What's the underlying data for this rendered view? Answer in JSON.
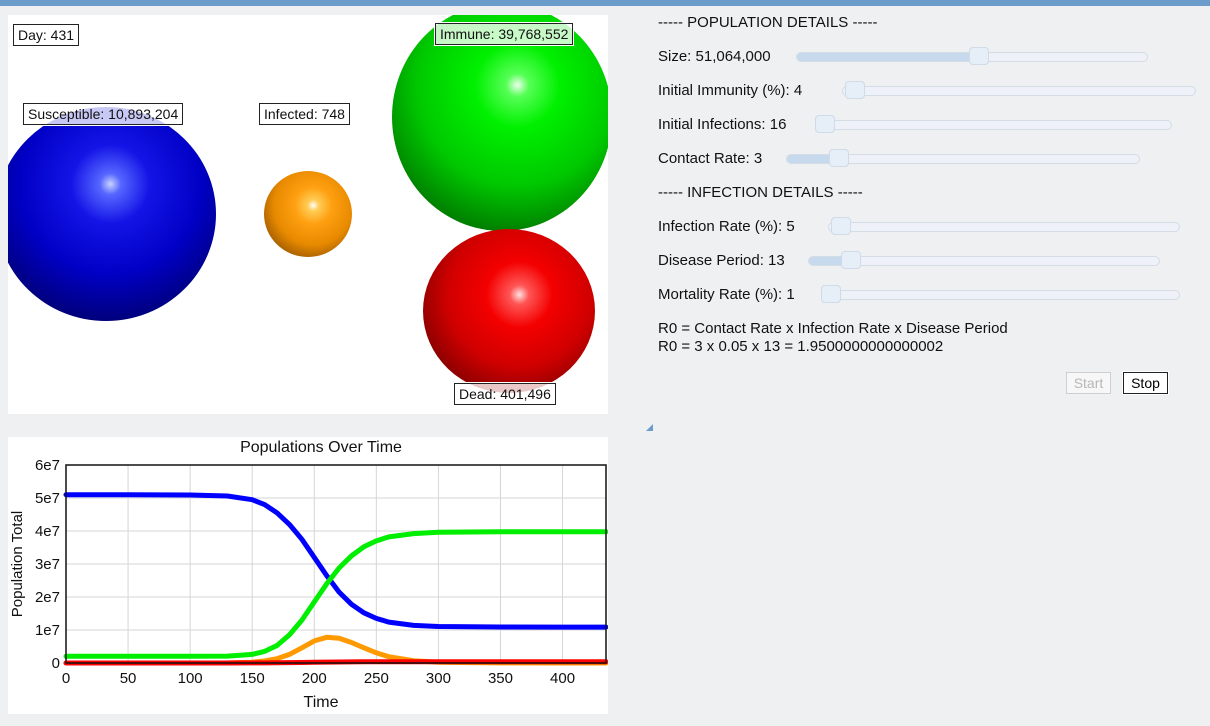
{
  "simulation": {
    "day_label": "Day: 431",
    "susceptible_label": "Susceptible: 10,893,204",
    "infected_label": "Infected: 748",
    "immune_label": "Immune: 39,768,552",
    "dead_label": "Dead: 401,496"
  },
  "controls": {
    "population_header": "----- POPULATION DETAILS -----",
    "size_label": "Size: 51,064,000",
    "size_value": 51064000,
    "initial_immunity_label": "Initial Immunity (%): 4",
    "initial_immunity_value": 4,
    "initial_infections_label": "Initial Infections: 16",
    "initial_infections_value": 16,
    "contact_rate_label": "Contact Rate: 3",
    "contact_rate_value": 3,
    "infection_header": "----- INFECTION DETAILS -----",
    "infection_rate_label": "Infection Rate (%): 5",
    "infection_rate_value": 5,
    "disease_period_label": "Disease Period: 13",
    "disease_period_value": 13,
    "mortality_rate_label": "Mortality Rate (%): 1",
    "mortality_rate_value": 1,
    "r0_formula": "R0 = Contact Rate x Infection Rate x Disease Period",
    "r0_value": "R0 = 3 x 0.05 x 13 = 1.9500000000000002",
    "start_label": "Start",
    "stop_label": "Stop"
  },
  "colors": {
    "susceptible": "#0000ff",
    "infected": "#ff9900",
    "immune": "#00ee00",
    "dead": "#ff0000",
    "accent": "#6c9ccc"
  },
  "chart_data": {
    "type": "line",
    "title": "Populations Over Time",
    "xlabel": "Time",
    "ylabel": "Population Total",
    "xlim": [
      0,
      435
    ],
    "ylim": [
      0,
      60000000
    ],
    "x_ticks": [
      "0",
      "50",
      "100",
      "150",
      "200",
      "250",
      "300",
      "350",
      "400"
    ],
    "y_ticks": [
      "0",
      "1e7",
      "2e7",
      "3e7",
      "4e7",
      "5e7",
      "6e7"
    ],
    "grid": true,
    "x": [
      0,
      50,
      100,
      130,
      150,
      160,
      170,
      180,
      190,
      200,
      210,
      220,
      230,
      240,
      250,
      260,
      280,
      300,
      350,
      400,
      435
    ],
    "series": [
      {
        "values": [
          51000000,
          51000000,
          50900000,
          50600000,
          49500000,
          48000000,
          45500000,
          42000000,
          37500000,
          32000000,
          26500000,
          21500000,
          17800000,
          15200000,
          13500000,
          12400000,
          11400000,
          11050000,
          10900000,
          10893000,
          10893204
        ]
      },
      {
        "values": [
          0,
          1000,
          5000,
          30000,
          250000,
          600000,
          1300000,
          2600000,
          4600000,
          6700000,
          7800000,
          7500000,
          6200000,
          4600000,
          3100000,
          1900000,
          700000,
          250000,
          20000,
          2000,
          748
        ]
      },
      {
        "values": [
          2040000,
          2041000,
          2050000,
          2100000,
          2600000,
          3500000,
          5300000,
          8500000,
          13000000,
          18500000,
          24000000,
          28800000,
          32500000,
          35200000,
          37000000,
          38200000,
          39200000,
          39600000,
          39760000,
          39768000,
          39768552
        ]
      },
      {
        "values": [
          0,
          0,
          0,
          5000,
          20000,
          40000,
          70000,
          110000,
          160000,
          210000,
          260000,
          300000,
          330000,
          355000,
          370000,
          380000,
          392000,
          398000,
          401200,
          401400,
          401496
        ]
      }
    ]
  }
}
